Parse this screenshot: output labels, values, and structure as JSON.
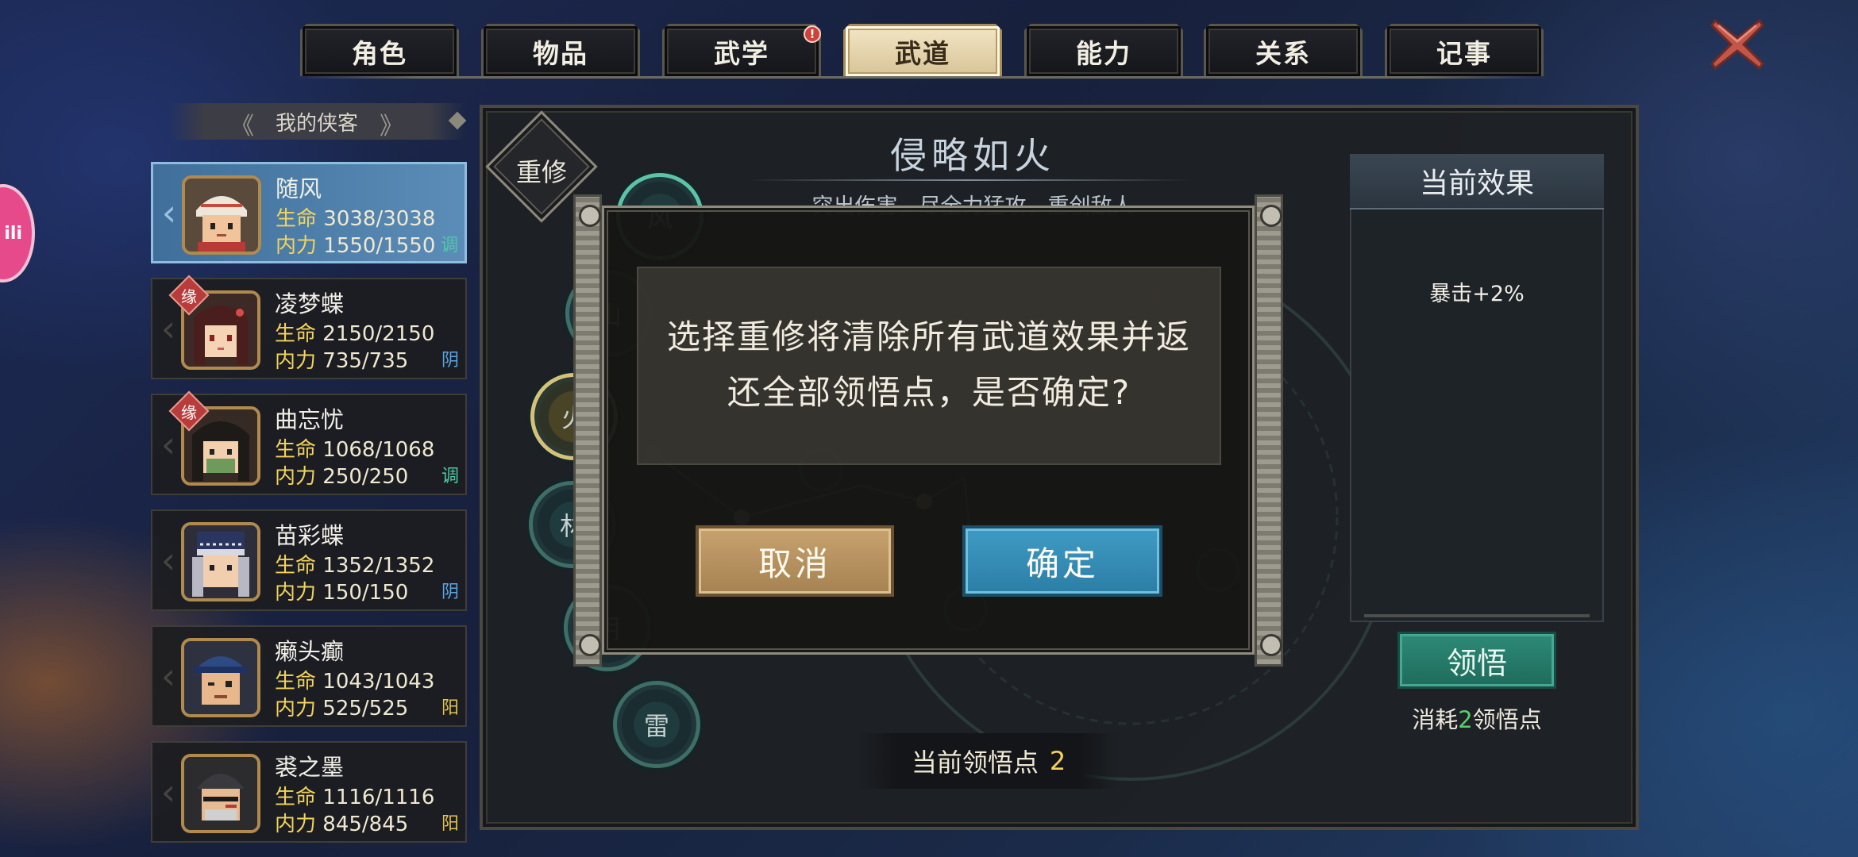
{
  "tabs": [
    {
      "label": "角色"
    },
    {
      "label": "物品"
    },
    {
      "label": "武学",
      "badge": "!"
    },
    {
      "label": "武道",
      "active": true
    },
    {
      "label": "能力"
    },
    {
      "label": "关系"
    },
    {
      "label": "记事"
    }
  ],
  "close_icon": "close-x-icon",
  "bili_label": "ili",
  "heroes_header": "我的侠客",
  "heroes": [
    {
      "name": "随风",
      "hp_label": "生命",
      "hp": "3038/3038",
      "mp_label": "内力",
      "mp": "1550/1550",
      "attr": "调",
      "attr_color": "#4fc9a6",
      "selected": true
    },
    {
      "name": "凌梦蝶",
      "hp_label": "生命",
      "hp": "2150/2150",
      "mp_label": "内力",
      "mp": "735/735",
      "attr": "阴",
      "attr_color": "#5aa6e6",
      "tag": "缘"
    },
    {
      "name": "曲忘忧",
      "hp_label": "生命",
      "hp": "1068/1068",
      "mp_label": "内力",
      "mp": "250/250",
      "attr": "调",
      "attr_color": "#4fc9a6",
      "tag": "缘"
    },
    {
      "name": "苗彩蝶",
      "hp_label": "生命",
      "hp": "1352/1352",
      "mp_label": "内力",
      "mp": "150/150",
      "attr": "阴",
      "attr_color": "#5aa6e6"
    },
    {
      "name": "癞头癫",
      "hp_label": "生命",
      "hp": "1043/1043",
      "mp_label": "内力",
      "mp": "525/525",
      "attr": "阳",
      "attr_color": "#e8c64a"
    },
    {
      "name": "裘之墨",
      "hp_label": "生命",
      "hp": "1116/1116",
      "mp_label": "内力",
      "mp": "845/845",
      "attr": "阳",
      "attr_color": "#e8c64a"
    }
  ],
  "path": {
    "title": "侵略如火",
    "description": "突出伤害，尽全力猛攻，重创敌人",
    "respec_label": "重修",
    "nodes": [
      "风",
      "山",
      "火",
      "林",
      "阴",
      "雷"
    ]
  },
  "current_points_label": "当前领悟点",
  "current_points": "2",
  "effect_panel": {
    "title": "当前效果",
    "items": [
      "暴击+2%"
    ],
    "comprehend_label": "领悟",
    "cost_prefix": "消耗",
    "cost_value": "2",
    "cost_suffix": "领悟点"
  },
  "modal": {
    "line1": "选择重修将清除所有武道效果并返",
    "line2": "还全部领悟点，是否确定?",
    "cancel_label": "取消",
    "confirm_label": "确定"
  }
}
